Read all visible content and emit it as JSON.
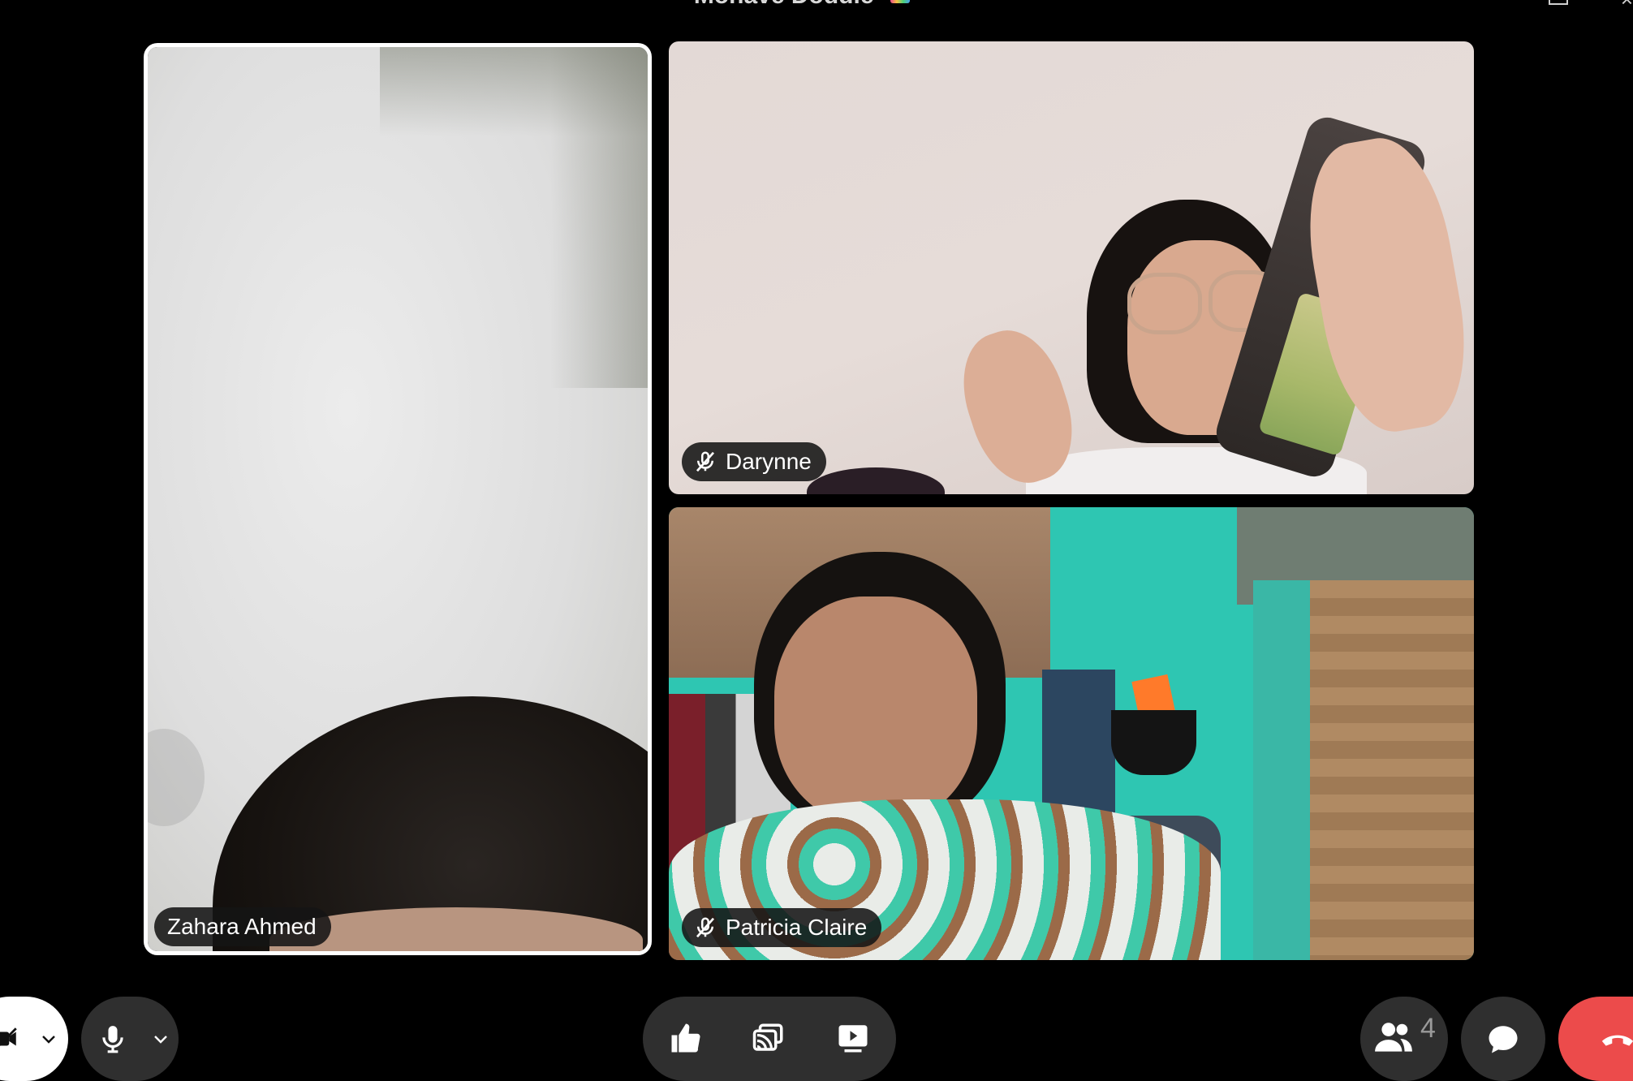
{
  "window": {
    "title": "Mohave Doddie",
    "title_visible": "• Mohave Doddie"
  },
  "participants": [
    {
      "name": "Zahara Ahmed",
      "muted": false,
      "active_speaker": true
    },
    {
      "name": "Darynne",
      "muted": true,
      "active_speaker": false
    },
    {
      "name": "Patricia Claire",
      "muted": true,
      "active_speaker": false
    }
  ],
  "controls": {
    "participant_count": "4",
    "end_call_color": "#ec4b4b",
    "icons": {
      "camera": "video-camera-icon",
      "mic": "microphone-icon",
      "react": "thumbs-up-icon",
      "share": "share-screen-icon",
      "present": "present-icon",
      "people": "people-icon",
      "chat": "chat-bubble-icon",
      "end": "hang-up-icon"
    }
  },
  "colors": {
    "background": "#000000",
    "control_bg": "#2f2f2f",
    "active_border": "#ffffff"
  }
}
